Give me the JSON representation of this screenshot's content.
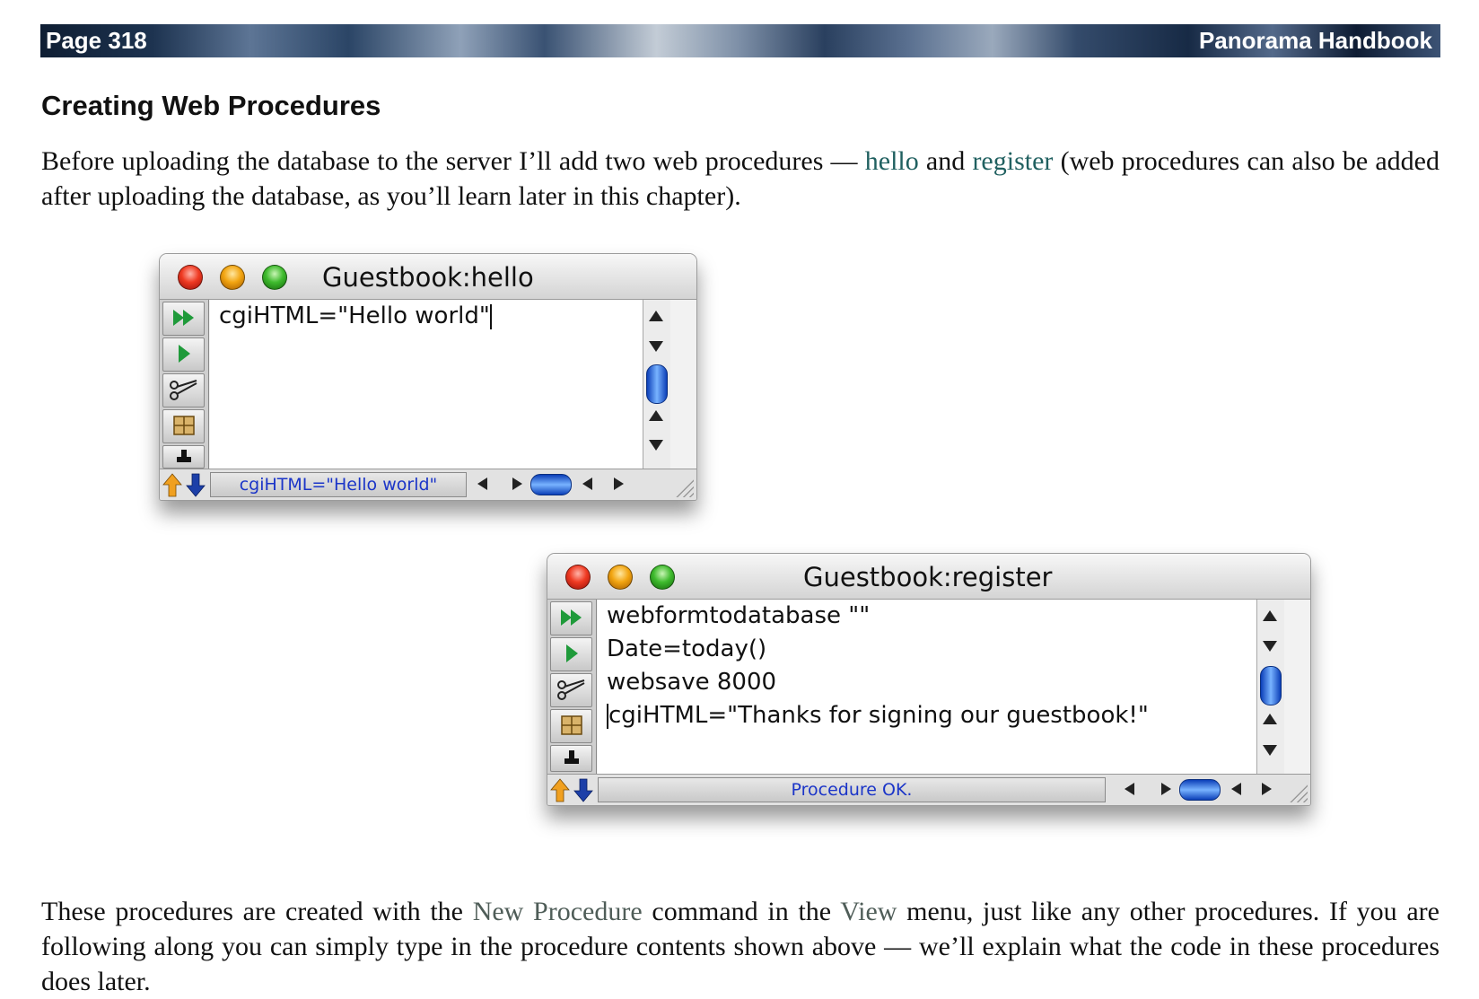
{
  "header": {
    "page_number": "Page 318",
    "book_title": "Panorama Handbook"
  },
  "section_title": "Creating Web Procedures",
  "intro": {
    "before": "Before uploading the database to the server I’ll add two web procedures — ",
    "link_hello": "hello",
    "middle": " and ",
    "link_register": "register",
    "after": " (web procedures can also be added after uploading the database, as you’ll learn later in this chapter)."
  },
  "window_hello": {
    "title": "Guestbook:hello",
    "code_lines": [
      "cgiHTML=\"Hello world\""
    ],
    "status": "cgiHTML=\"Hello world\""
  },
  "window_register": {
    "title": "Guestbook:register",
    "code_lines": [
      "webformtodatabase \"\"",
      "Date=today()",
      "websave 8000",
      "cgiHTML=\"Thanks for signing our guestbook!\""
    ],
    "status": "Procedure OK."
  },
  "closing": {
    "before": "These procedures are created with the ",
    "cmd_new_procedure": "New Procedure",
    "middle": " command in the ",
    "menu_view": "View",
    "after": " menu, just like any other procedures. If you are following along you can simply type in the procedure contents shown above — we’ll explain what the code in these procedures does later."
  },
  "colors": {
    "link_teal": "#206060",
    "menu_gray": "#4f5d58",
    "status_blue": "#1b35c8"
  }
}
